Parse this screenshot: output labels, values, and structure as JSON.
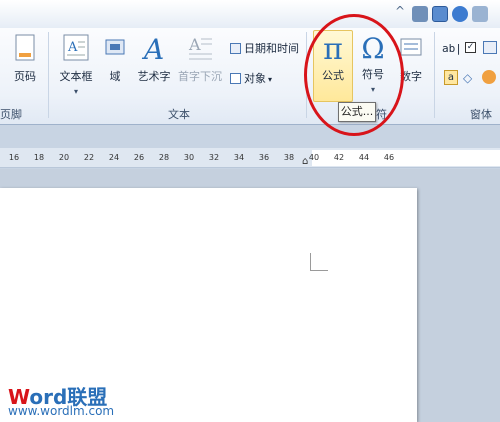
{
  "ribbon": {
    "buttons": {
      "page_number": "页码",
      "text_box": "文本框",
      "field": "域",
      "word_art": "艺术字",
      "drop_cap": "首字下沉",
      "date_time": "日期和时间",
      "object": "对象",
      "formula": "公式",
      "symbol": "符号",
      "number": "数字",
      "ab": "ab|"
    },
    "groups": {
      "header_footer": "页脚",
      "text": "文本",
      "symbols_partial": "符",
      "form": "窗体"
    }
  },
  "tooltip": {
    "text": "公式..."
  },
  "ruler": {
    "ticks": [
      "16",
      "18",
      "20",
      "22",
      "24",
      "26",
      "28",
      "30",
      "32",
      "34",
      "36",
      "38",
      "40",
      "42",
      "44",
      "46"
    ]
  },
  "watermark": {
    "brand_w": "W",
    "brand_rest": "ord联盟",
    "url": "www.wordlm.com"
  },
  "colors": {
    "accent": "#2a6fb8",
    "highlight": "#ffe89a",
    "annotation": "#d8141a"
  }
}
